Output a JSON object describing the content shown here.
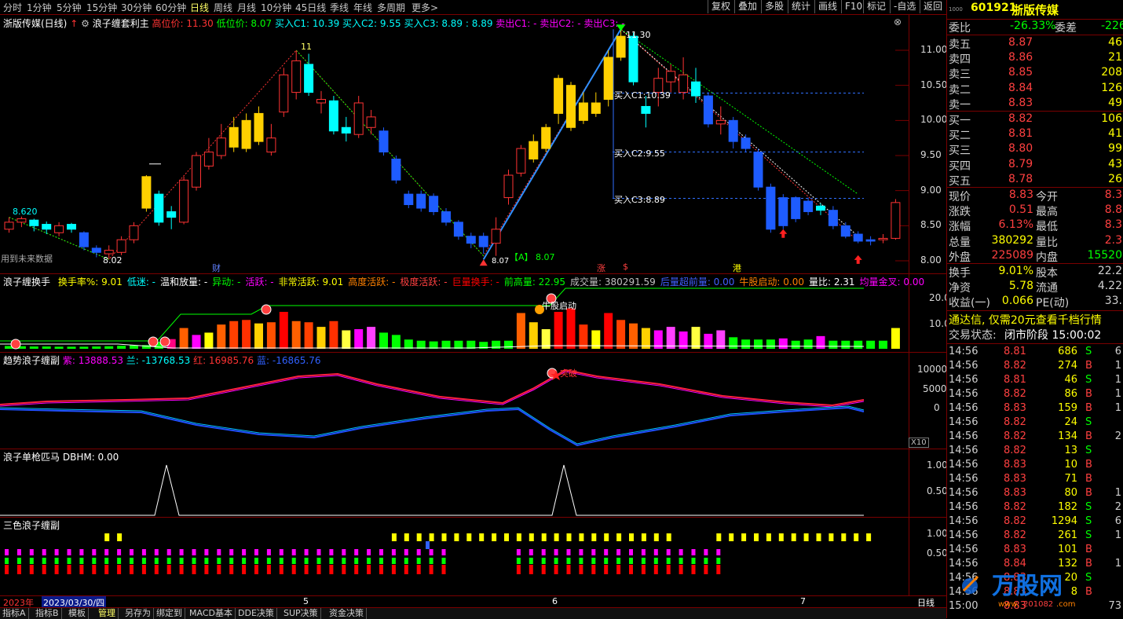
{
  "toolbar": {
    "periods": [
      "分时",
      "1分钟",
      "5分钟",
      "15分钟",
      "30分钟",
      "60分钟",
      "日线",
      "周线",
      "月线",
      "10分钟",
      "45日线",
      "季线",
      "年线",
      "多周期",
      "更多>"
    ],
    "active_period": "日线",
    "right_buttons": [
      "复权",
      "叠加",
      "多股",
      "统计",
      "画线",
      "F10",
      "标记",
      "-自选",
      "返回"
    ]
  },
  "main_chart": {
    "stock_title": "浙版传媒(日线)",
    "indicator_name": "浪子缠套利主",
    "high_label": "高位价: 11.30",
    "low_label": "低位价: 8.07",
    "buy_c1": "买入C1: 10.39",
    "buy_c2": "买入C2: 9.55",
    "buy_c3": "买入C3: 8.89",
    "buy_c3_tail": ": 8.89",
    "sell_c1": "卖出C1: -",
    "sell_c2": "卖出C2: -",
    "sell_c3": "卖出C3: -",
    "y_ticks": [
      "11.00",
      "10.50",
      "10.00",
      "9.50",
      "9.00",
      "8.50",
      "8.00"
    ],
    "annot_high": "11",
    "annot_high2": "11.30",
    "annot_low_left": "8.620",
    "annot_low_mid": "8.02",
    "annot_low_a": "【A】 8.07",
    "annot_lowval": "8.07",
    "label_c1": "买入C1:10.39",
    "label_c2": "买入C2:9.55",
    "label_c3": "买入C3:8.89",
    "future_note": "用到未来数据",
    "mark_cai": "财",
    "mark_zhang": "涨",
    "mark_s": "$",
    "mark_gang": "港"
  },
  "panel2": {
    "title": "浪子缠换手",
    "items": [
      {
        "text": "换手率%: 9.01",
        "color": "#ffff00"
      },
      {
        "text": "低迷: -",
        "color": "#00ffff"
      },
      {
        "text": "温和放量: -",
        "color": "#ffffff"
      },
      {
        "text": "异动: -",
        "color": "#00ff00"
      },
      {
        "text": "活跃: -",
        "color": "#ff00ff"
      },
      {
        "text": "非常活跃: 9.01",
        "color": "#ffff00"
      },
      {
        "text": "高度活跃: -",
        "color": "#ff8000"
      },
      {
        "text": "极度活跃: -",
        "color": "#ff4040"
      },
      {
        "text": "巨量换手: -",
        "color": "#ff0000"
      },
      {
        "text": "前高量: 22.95",
        "color": "#00ff00"
      },
      {
        "text": "成交量: 380291.59",
        "color": "#c0c0c0"
      },
      {
        "text": "后量超前量: 0.00",
        "color": "#4060ff"
      },
      {
        "text": "牛股启动: 0.00",
        "color": "#ff8000"
      },
      {
        "text": "量比: 2.31",
        "color": "#ffffff"
      },
      {
        "text": "均量金叉: 0.00",
        "color": "#ff00ff"
      }
    ],
    "y_ticks": [
      "20.00",
      "10.00"
    ],
    "annot": "牛股启动"
  },
  "panel3": {
    "title": "趋势浪子缠副",
    "purple": "紫: 13888.53",
    "blue_lan": "兰: -13768.53",
    "red": "红: 16985.76",
    "blue": "蓝: -16865.76",
    "y_ticks": [
      "10000",
      "5000",
      "0"
    ],
    "scale": "X10",
    "annot": "突破"
  },
  "panel4": {
    "title": "浪子单枪匹马",
    "value": "DBHM: 0.00",
    "y_ticks": [
      "1.00",
      "0.50"
    ]
  },
  "panel5": {
    "title": "三色浪子缠副",
    "y_ticks": [
      "1.00",
      "0.50"
    ]
  },
  "datebar": {
    "year": "2023年",
    "date": "2023/03/30/四",
    "months": [
      "5",
      "6",
      "7"
    ],
    "period": "日线"
  },
  "bottom_tabs": [
    "指标A",
    "指标B",
    "模板",
    "管理",
    "另存为",
    "绑定到",
    "MACD基本",
    "DDE决策",
    "SUP决策",
    "资金决策"
  ],
  "quote": {
    "code": "601921",
    "name": "浙版传媒",
    "weibi_label": "委比",
    "weibi": "-26.33%",
    "weicha_label": "委差",
    "weicha": "-226",
    "asks": [
      {
        "label": "卖五",
        "price": "8.87",
        "vol": "46"
      },
      {
        "label": "卖四",
        "price": "8.86",
        "vol": "21"
      },
      {
        "label": "卖三",
        "price": "8.85",
        "vol": "208"
      },
      {
        "label": "卖二",
        "price": "8.84",
        "vol": "126"
      },
      {
        "label": "卖一",
        "price": "8.83",
        "vol": "49"
      }
    ],
    "bids": [
      {
        "label": "买一",
        "price": "8.82",
        "vol": "106"
      },
      {
        "label": "买二",
        "price": "8.81",
        "vol": "41"
      },
      {
        "label": "买三",
        "price": "8.80",
        "vol": "99"
      },
      {
        "label": "买四",
        "price": "8.79",
        "vol": "43"
      },
      {
        "label": "买五",
        "price": "8.78",
        "vol": "26"
      }
    ],
    "stats": [
      {
        "l1": "现价",
        "v1": "8.83",
        "c1": "#ff4040",
        "l2": "今开",
        "v2": "8.3",
        "c2": "#ff4040"
      },
      {
        "l1": "涨跌",
        "v1": "0.51",
        "c1": "#ff4040",
        "l2": "最高",
        "v2": "8.8",
        "c2": "#ff4040"
      },
      {
        "l1": "涨幅",
        "v1": "6.13%",
        "c1": "#ff4040",
        "l2": "最低",
        "v2": "8.3",
        "c2": "#ff4040"
      },
      {
        "l1": "总量",
        "v1": "380292",
        "c1": "#ffff00",
        "l2": "量比",
        "v2": "2.3",
        "c2": "#ff4040"
      },
      {
        "l1": "外盘",
        "v1": "225089",
        "c1": "#ff4040",
        "l2": "内盘",
        "v2": "15520",
        "c2": "#00ff00"
      }
    ],
    "stats2": [
      {
        "l1": "换手",
        "v1": "9.01%",
        "l2": "股本",
        "v2": "22.2"
      },
      {
        "l1": "净资",
        "v1": "5.78",
        "l2": "流通",
        "v2": "4.22"
      },
      {
        "l1": "收益(一)",
        "v1": "0.066",
        "l2": "PE(动)",
        "v2": "33."
      }
    ],
    "ad": "通达信, 仅需20元查看千档行情",
    "status_label": "交易状态:",
    "status": "闭市阶段 15:00:02",
    "ticks": [
      {
        "t": "14:56",
        "p": "8.81",
        "v": "686",
        "bs": "S",
        "n": "6"
      },
      {
        "t": "14:56",
        "p": "8.82",
        "v": "274",
        "bs": "B",
        "n": "1"
      },
      {
        "t": "14:56",
        "p": "8.81",
        "v": "46",
        "bs": "S",
        "n": "1"
      },
      {
        "t": "14:56",
        "p": "8.82",
        "v": "86",
        "bs": "B",
        "n": "1"
      },
      {
        "t": "14:56",
        "p": "8.83",
        "v": "159",
        "bs": "B",
        "n": "1"
      },
      {
        "t": "14:56",
        "p": "8.82",
        "v": "24",
        "bs": "S",
        "n": ""
      },
      {
        "t": "14:56",
        "p": "8.82",
        "v": "134",
        "bs": "B",
        "n": "2"
      },
      {
        "t": "14:56",
        "p": "8.82",
        "v": "13",
        "bs": "S",
        "n": ""
      },
      {
        "t": "14:56",
        "p": "8.83",
        "v": "10",
        "bs": "B",
        "n": ""
      },
      {
        "t": "14:56",
        "p": "8.83",
        "v": "71",
        "bs": "B",
        "n": ""
      },
      {
        "t": "14:56",
        "p": "8.83",
        "v": "80",
        "bs": "B",
        "n": "1"
      },
      {
        "t": "14:56",
        "p": "8.82",
        "v": "182",
        "bs": "S",
        "n": "2"
      },
      {
        "t": "14:56",
        "p": "8.82",
        "v": "1294",
        "bs": "S",
        "n": "6"
      },
      {
        "t": "14:56",
        "p": "8.82",
        "v": "261",
        "bs": "S",
        "n": "1"
      },
      {
        "t": "14:56",
        "p": "8.83",
        "v": "101",
        "bs": "B",
        "n": ""
      },
      {
        "t": "14:56",
        "p": "8.84",
        "v": "132",
        "bs": "B",
        "n": "1"
      },
      {
        "t": "14:56",
        "p": "8.83",
        "v": "20",
        "bs": "S",
        "n": ""
      },
      {
        "t": "14:56",
        "p": "8.83",
        "v": "8",
        "bs": "B",
        "n": ""
      },
      {
        "t": "15:00",
        "p": "8.83",
        "v": "",
        "bs": "",
        "n": "73"
      }
    ]
  },
  "colors": {
    "up": "#ff3333",
    "down": "#00ffff",
    "yellow": "#ffff00",
    "blue": "#1e5cff",
    "grid": "#7a0000"
  }
}
